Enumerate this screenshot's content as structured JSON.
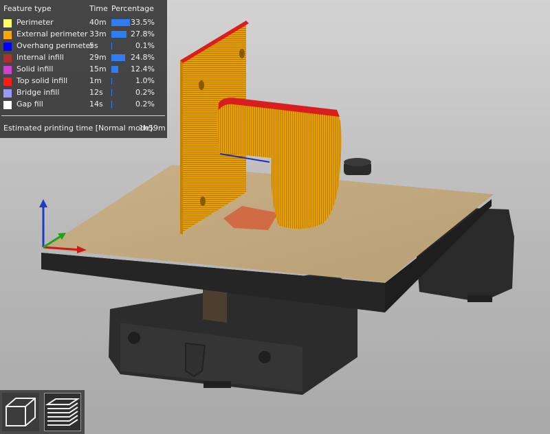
{
  "legend": {
    "header": {
      "feature": "Feature type",
      "time": "Time",
      "percentage": "Percentage"
    },
    "rows": [
      {
        "name": "Perimeter",
        "time": "40m",
        "percent": "33.5%",
        "fraction": 0.335,
        "color": "#ffff66"
      },
      {
        "name": "External perimeter",
        "time": "33m",
        "percent": "27.8%",
        "fraction": 0.278,
        "color": "#ffa500"
      },
      {
        "name": "Overhang perimeter",
        "time": "5s",
        "percent": "0.1%",
        "fraction": 0.001,
        "color": "#0000ff"
      },
      {
        "name": "Internal infill",
        "time": "29m",
        "percent": "24.8%",
        "fraction": 0.248,
        "color": "#b03029"
      },
      {
        "name": "Solid infill",
        "time": "15m",
        "percent": "12.4%",
        "fraction": 0.124,
        "color": "#d040d0"
      },
      {
        "name": "Top solid infill",
        "time": "1m",
        "percent": "1.0%",
        "fraction": 0.01,
        "color": "#ff1a1a"
      },
      {
        "name": "Bridge infill",
        "time": "12s",
        "percent": "0.2%",
        "fraction": 0.002,
        "color": "#9999ff"
      },
      {
        "name": "Gap fill",
        "time": "14s",
        "percent": "0.2%",
        "fraction": 0.002,
        "color": "#ffffff"
      }
    ],
    "estimate_label": "Estimated printing time [Normal mode]:",
    "estimate_value": "1h59m"
  },
  "toolbar": {
    "buttons": [
      {
        "icon": "3d-view-icon",
        "active": false
      },
      {
        "icon": "gcode-preview-icon",
        "active": true
      }
    ]
  },
  "colors": {
    "bar": "#2e7df2",
    "panel": "#3a3a3a",
    "printed_part": "#e8a000",
    "top_layer": "#d81e1e"
  }
}
